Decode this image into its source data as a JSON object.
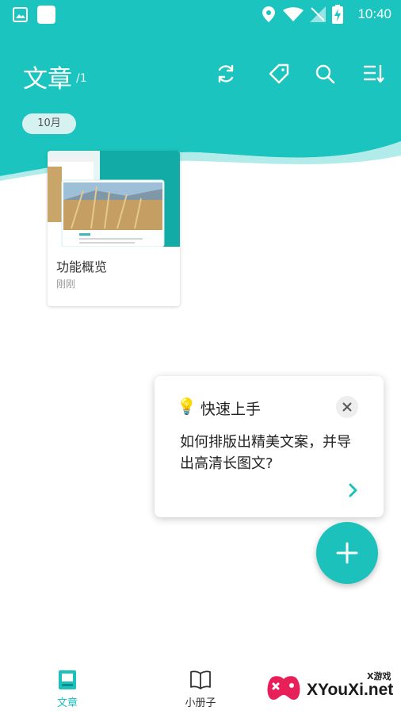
{
  "status_bar": {
    "time": "10:40"
  },
  "header": {
    "title": "文章",
    "count": "/1",
    "month": "10月"
  },
  "header_icons": [
    "sync-icon",
    "tag-icon",
    "search-icon",
    "sort-icon"
  ],
  "articles": [
    {
      "title": "功能概览",
      "time": "刚刚"
    }
  ],
  "tip": {
    "title": "快速上手",
    "body": "如何排版出精美文案，并导出高清长图文?"
  },
  "nav": [
    {
      "label": "文章",
      "active": true
    },
    {
      "label": "小册子",
      "active": false
    }
  ],
  "watermark": {
    "text": "XYouXi.net",
    "sub": "X游戏"
  },
  "colors": {
    "accent": "#1cc1bc",
    "header": "#1bc4be"
  }
}
